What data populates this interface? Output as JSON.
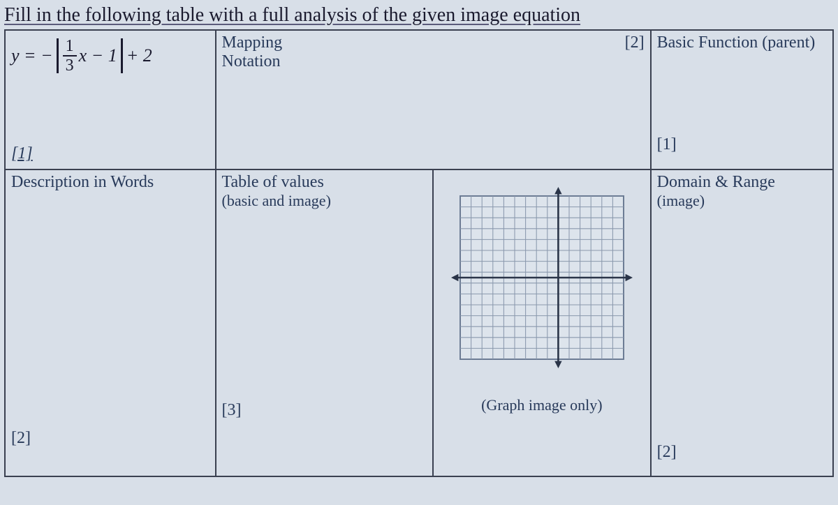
{
  "title": "Fill in the following table with a full analysis of the given image equation",
  "equation": {
    "prefix": "y = −",
    "abs_open": "|",
    "frac_num": "1",
    "frac_den": "3",
    "inner_suffix": "x − 1",
    "abs_close": "|",
    "outer_suffix": " + 2"
  },
  "cells": {
    "mapping": {
      "line1": "Mapping",
      "line2": "Notation",
      "mark": "[2]"
    },
    "basic_function": {
      "label": "Basic Function (parent)",
      "mark": "[1]"
    },
    "equation_mark": "[1]",
    "description": {
      "label": "Description in Words",
      "mark": "[2]"
    },
    "table_values": {
      "line1": "Table of values",
      "line2": "(basic and image)",
      "mark": "[3]"
    },
    "graph": {
      "caption": "(Graph image only)"
    },
    "domain_range": {
      "line1": "Domain & Range",
      "line2": "(image)",
      "mark": "[2]"
    }
  }
}
